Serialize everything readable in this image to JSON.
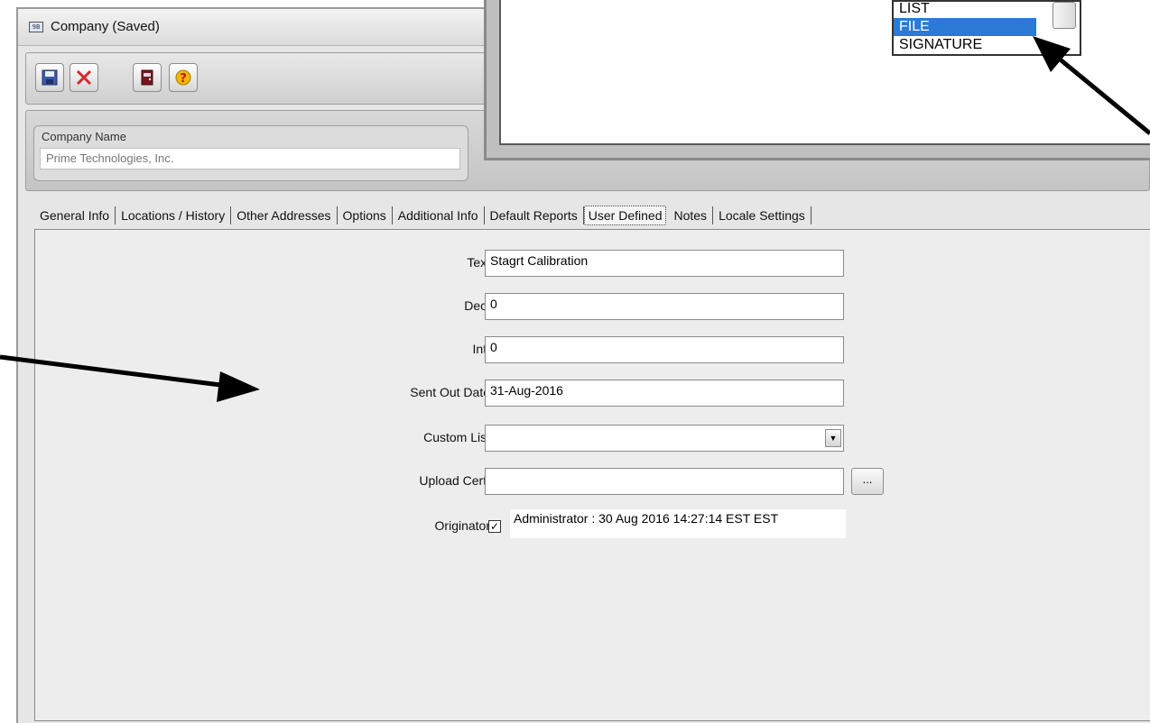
{
  "window": {
    "title": "Company (Saved)",
    "title_icon_text": "9B"
  },
  "toolbar": {
    "buttons": [
      {
        "name": "save-icon"
      },
      {
        "name": "delete-icon"
      },
      {
        "name": "exit-door-icon"
      },
      {
        "name": "help-icon"
      }
    ]
  },
  "company": {
    "label": "Company Name",
    "value": "Prime Technologies, Inc."
  },
  "tabs": [
    "General Info",
    "Locations / History",
    "Other Addresses",
    "Options",
    "Additional Info",
    "Default Reports",
    "User Defined",
    "Notes",
    "Locale Settings"
  ],
  "active_tab": "User Defined",
  "fields": {
    "text": {
      "label": "Text",
      "value": "Stagrt Calibration"
    },
    "dec": {
      "label": "Dec.",
      "value": "0"
    },
    "int": {
      "label": "Int.",
      "value": "0"
    },
    "sent_out_date": {
      "label": "Sent Out Date",
      "value": "31-Aug-2016"
    },
    "custom_list": {
      "label": "Custom List",
      "value": ""
    },
    "upload_cert": {
      "label": "Upload Cert.",
      "value": "",
      "browse": "..."
    },
    "originator": {
      "label": "Originator",
      "checked": true,
      "value": "Administrator : 30 Aug 2016 14:27:14 EST EST"
    }
  },
  "popup_list": {
    "items": [
      "LIST",
      "FILE",
      "SIGNATURE"
    ],
    "selected": "FILE"
  },
  "colors": {
    "selection": "#2a7ad6",
    "delete": "#d22b2b",
    "help": "#f2b800"
  }
}
